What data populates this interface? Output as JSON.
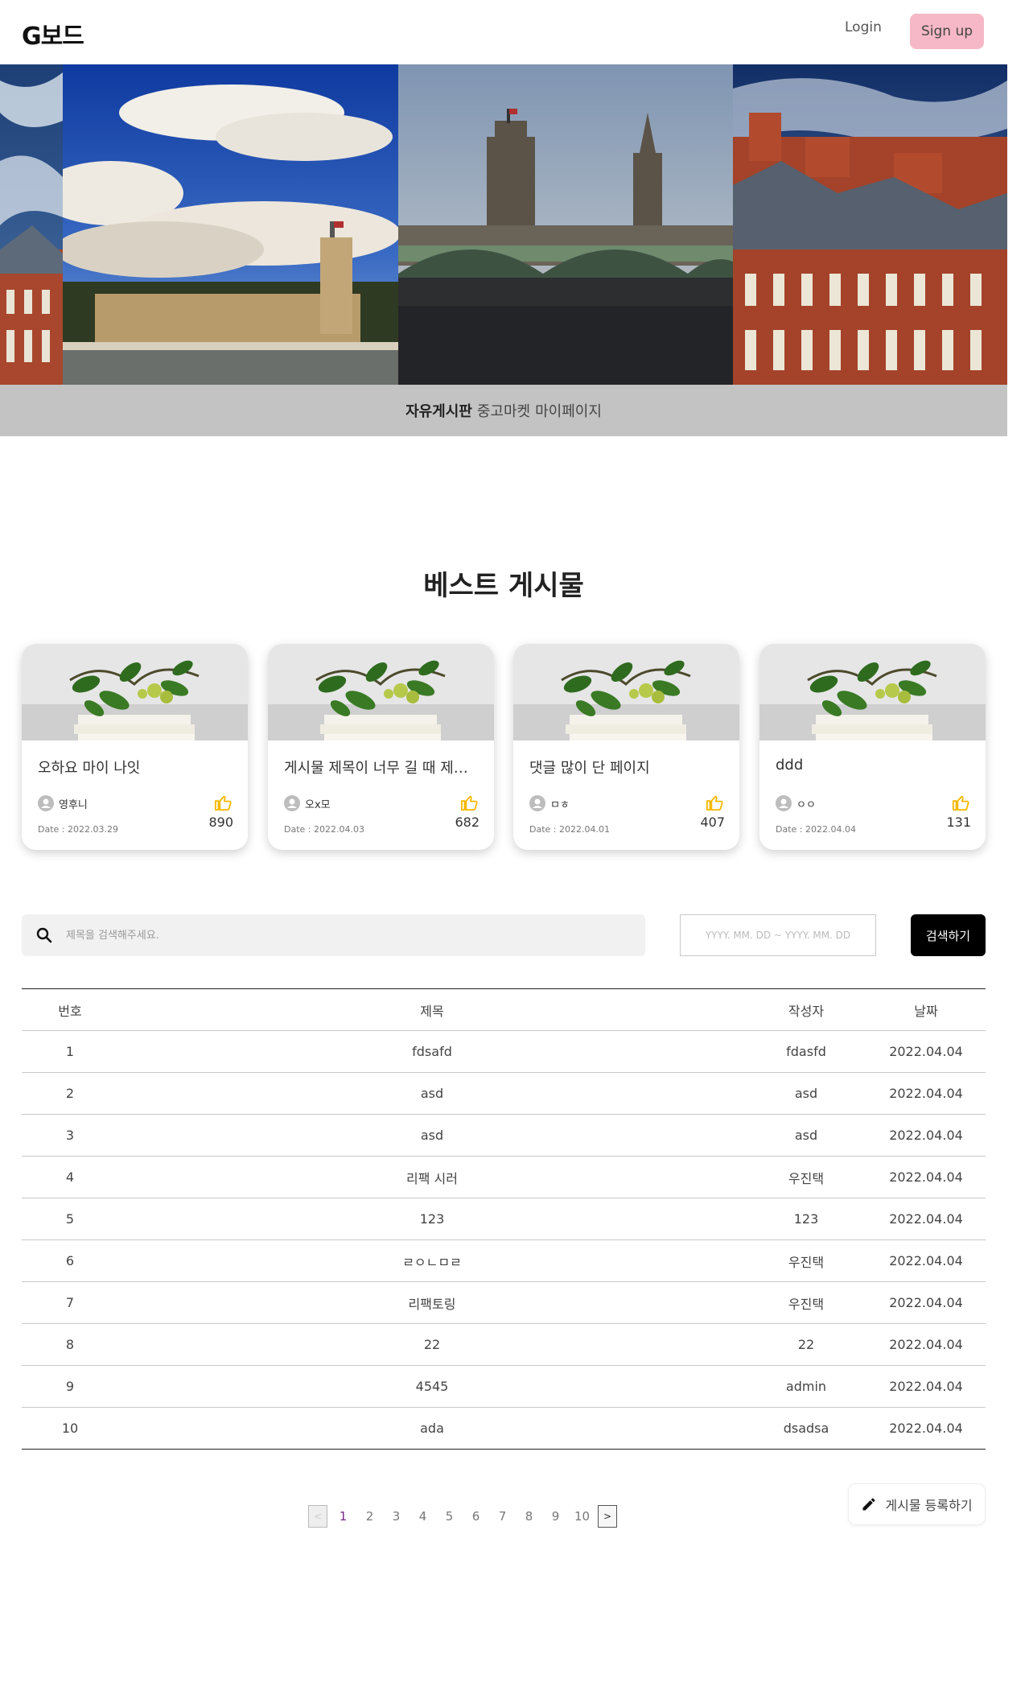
{
  "header": {
    "logo": "G보드",
    "login_label": "Login",
    "signup_label": "Sign up"
  },
  "nav": {
    "items": [
      {
        "label": "자유게시판",
        "active": true
      },
      {
        "label": "중고마켓",
        "active": false
      },
      {
        "label": "마이페이지",
        "active": false
      }
    ]
  },
  "best": {
    "title": "베스트 게시물",
    "cards": [
      {
        "title": "오하요 마이 나잇",
        "author": "영후니",
        "date": "Date : 2022.03.29",
        "likes": "890"
      },
      {
        "title": "게시물 제목이 너무 길 때 제목 ...",
        "author": "오x모",
        "date": "Date : 2022.04.03",
        "likes": "682"
      },
      {
        "title": "댓글 많이 단 페이지",
        "author": "ㅁㅎ",
        "date": "Date : 2022.04.01",
        "likes": "407"
      },
      {
        "title": "ddd",
        "author": "ㅇㅇ",
        "date": "Date : 2022.04.04",
        "likes": "131"
      }
    ]
  },
  "search": {
    "placeholder": "제목을 검색해주세요.",
    "date_placeholder": "YYYY. MM. DD ~ YYYY. MM. DD",
    "button_label": "검색하기"
  },
  "table": {
    "headers": [
      "번호",
      "제목",
      "작성자",
      "날짜"
    ],
    "rows": [
      {
        "no": "1",
        "title": "fdsafd",
        "writer": "fdasfd",
        "date": "2022.04.04"
      },
      {
        "no": "2",
        "title": "asd",
        "writer": "asd",
        "date": "2022.04.04"
      },
      {
        "no": "3",
        "title": "asd",
        "writer": "asd",
        "date": "2022.04.04"
      },
      {
        "no": "4",
        "title": "리팩 시러",
        "writer": "우진택",
        "date": "2022.04.04"
      },
      {
        "no": "5",
        "title": "123",
        "writer": "123",
        "date": "2022.04.04"
      },
      {
        "no": "6",
        "title": "ㄹㅇㄴㅁㄹ",
        "writer": "우진택",
        "date": "2022.04.04"
      },
      {
        "no": "7",
        "title": "리팩토링",
        "writer": "우진택",
        "date": "2022.04.04"
      },
      {
        "no": "8",
        "title": "22",
        "writer": "22",
        "date": "2022.04.04"
      },
      {
        "no": "9",
        "title": "4545",
        "writer": "admin",
        "date": "2022.04.04"
      },
      {
        "no": "10",
        "title": "ada",
        "writer": "dsadsa",
        "date": "2022.04.04"
      }
    ]
  },
  "pagination": {
    "prev_label": "<",
    "next_label": ">",
    "pages": [
      "1",
      "2",
      "3",
      "4",
      "5",
      "6",
      "7",
      "8",
      "9",
      "10"
    ],
    "current_page": "1"
  },
  "write_button_label": "게시물 등록하기",
  "colors": {
    "signup_bg": "#f6b8c6",
    "nav_bg": "#c4c3c3",
    "like_icon": "#f5b800",
    "search_button_bg": "#000000",
    "active_page": "#7a2a8a"
  },
  "icons": [
    "user-circle-icon",
    "thumbs-up-icon",
    "search-icon",
    "pencil-icon"
  ]
}
